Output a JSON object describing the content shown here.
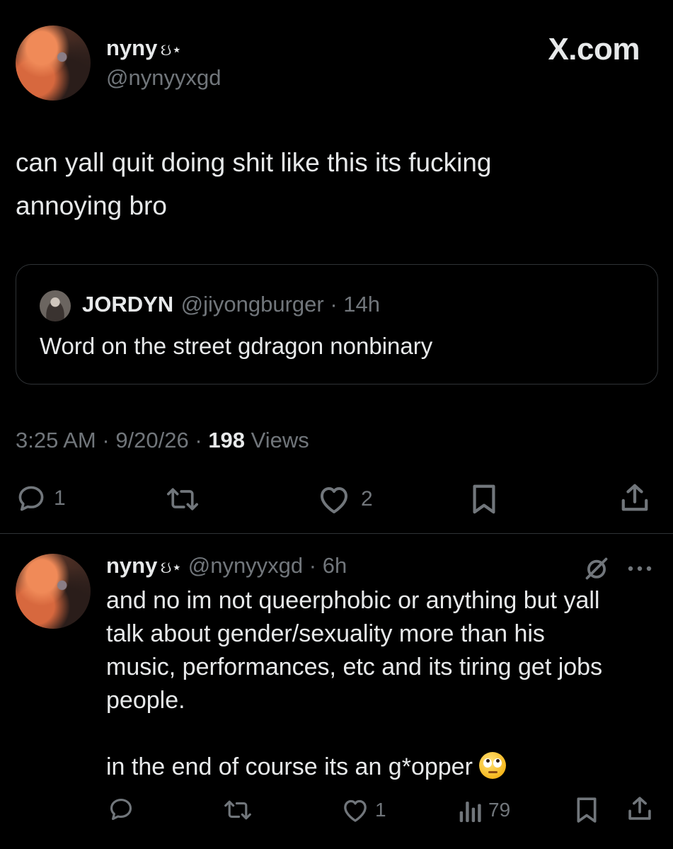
{
  "main_tweet": {
    "display_name": "nyny",
    "name_decoration": "ઇ⋆",
    "handle": "@nynyyxgd",
    "brand": "X.com",
    "text": "can yall quit doing shit like this its fucking\nannoying bro",
    "quote": {
      "name": "JORDYN",
      "handle": "@jiyongburger",
      "time": "14h",
      "text": "Word on the street gdragon nonbinary"
    },
    "time": "3:25 AM",
    "date": "9/20/26",
    "views_count": "198",
    "views_label": "Views",
    "replies": "1",
    "likes": "2"
  },
  "reply_tweet": {
    "display_name": "nyny",
    "name_decoration": "ઇ⋆",
    "handle": "@nynyyxgd",
    "time": "6h",
    "text": "and no im not queerphobic or anything but yall\ntalk about gender/sexuality more than his\nmusic, performances, etc and its tiring get jobs\npeople.\n\nin the end of course its an g*opper",
    "emoji": "rolling-eyes",
    "likes": "1",
    "views": "79"
  },
  "icons": {
    "reply": "reply-icon",
    "repost": "repost-icon",
    "like": "heart-icon",
    "bookmark": "bookmark-icon",
    "share": "share-icon",
    "views": "views-icon",
    "grok": "slashed-circle-icon",
    "more": "more-icon"
  },
  "colors": {
    "background": "#000000",
    "text": "#e7e9ea",
    "muted": "#71767b",
    "border": "#2f3336"
  }
}
